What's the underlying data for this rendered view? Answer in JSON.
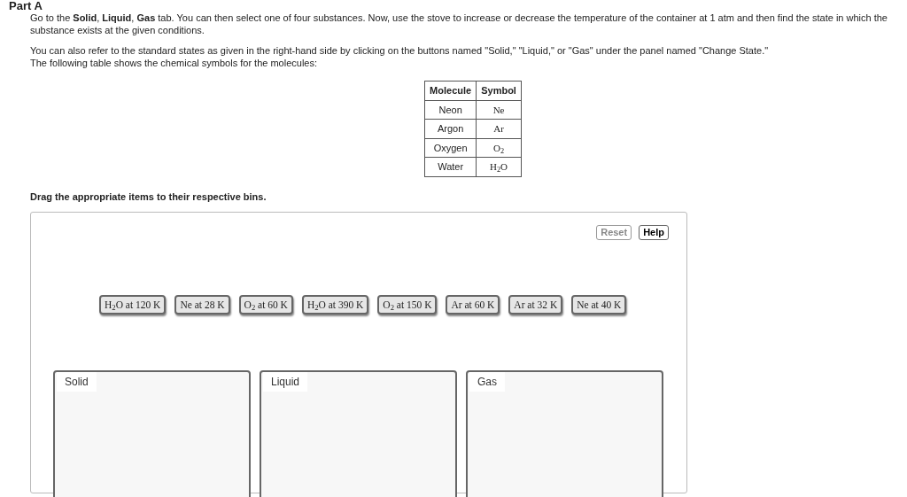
{
  "part_title": "Part A",
  "paragraphs": [
    "Go to the **Solid**, **Liquid**, **Gas** tab. You can then select one of four substances. Now, use the stove to increase or decrease the temperature of the container at 1 atm and then find the state in which the substance exists at the given conditions.",
    "You can also refer to the standard states as given in the right-hand side by clicking on the buttons named \"Solid,\" \"Liquid,\" or \"Gas\" under the panel named \"Change State.\"",
    "The following table shows the chemical symbols for the molecules:"
  ],
  "table": {
    "columns": [
      "Molecule",
      "Symbol"
    ],
    "rows": [
      [
        "Neon",
        "Ne"
      ],
      [
        "Argon",
        "Ar"
      ],
      [
        "Oxygen",
        "O$_{2}$"
      ],
      [
        "Water",
        "H$_{2}$O"
      ]
    ]
  },
  "instruction": "Drag the appropriate items to their respective bins.",
  "toolbar": [
    {
      "label": "Reset",
      "disabled": true
    },
    {
      "label": "Help",
      "disabled": false
    }
  ],
  "items": [
    "H$_{2}$O at 120 K",
    "Ne at 28 K",
    "O$_{2}$ at 60 K",
    "H$_{2}$O at 390 K",
    "O$_{2}$ at 150 K",
    "Ar at 60 K",
    "Ar at 32 K",
    "Ne at 40 K"
  ],
  "bins": [
    "Solid",
    "Liquid",
    "Gas"
  ]
}
